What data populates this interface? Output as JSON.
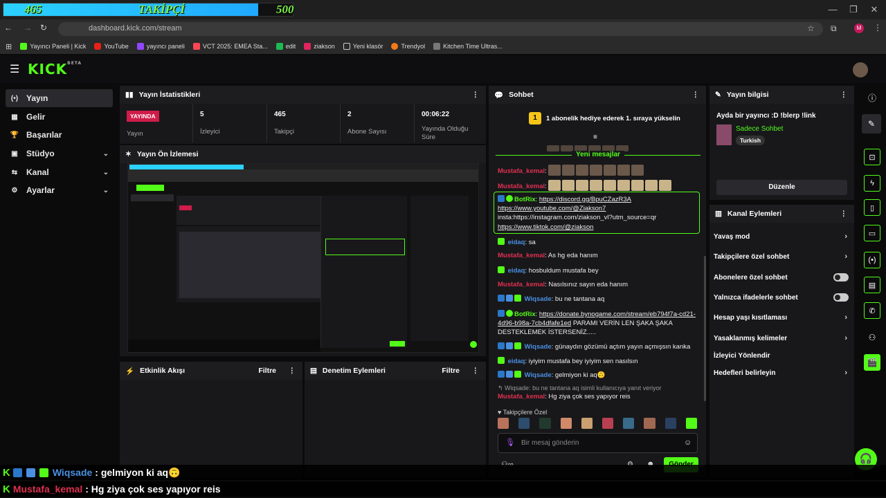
{
  "goal_bar": {
    "current": "465",
    "label": "TAKİPÇİ",
    "target": "500"
  },
  "browser": {
    "url": "dashboard.kick.com/stream",
    "bookmarks": [
      "Yayıncı Paneli | Kick",
      "YouTube",
      "yayıncı paneli",
      "VCT 2025: EMEA Sta...",
      "edit",
      "ziakson",
      "Yeni klasör",
      "Trendyol",
      "Kitchen Time Ultras..."
    ],
    "profile_initial": "M"
  },
  "header": {
    "logo": "KICK",
    "logo_sup": "BETA"
  },
  "sidebar": {
    "items": [
      {
        "label": "Yayın",
        "icon": "(•)"
      },
      {
        "label": "Gelir",
        "icon": "▦"
      },
      {
        "label": "Başarılar",
        "icon": "🏆"
      },
      {
        "label": "Stüdyo",
        "icon": "▣"
      },
      {
        "label": "Kanal",
        "icon": "⇆"
      },
      {
        "label": "Ayarlar",
        "icon": "⚙"
      }
    ]
  },
  "stats": {
    "title": "Yayın İstatistikleri",
    "live_badge": "YAYINDA",
    "status_label": "Yayın",
    "viewers": {
      "value": "5",
      "label": "İzleyici"
    },
    "followers": {
      "value": "465",
      "label": "Takipçi"
    },
    "subs": {
      "value": "2",
      "label": "Abone Sayısı"
    },
    "uptime": {
      "value": "00:06:22",
      "label": "Yayında Olduğu Süre"
    }
  },
  "preview": {
    "title": "Yayın Ön İzlemesi"
  },
  "activity": {
    "title": "Etkinlik Akışı",
    "filter": "Filtre"
  },
  "moderation": {
    "title": "Denetim Eylemleri",
    "filter": "Filtre"
  },
  "chat": {
    "title": "Sohbet",
    "pinned": "1 abonelik hediye ederek 1. sıraya yükselin",
    "pinned_rank": "1",
    "new_messages": "Yeni mesajlar",
    "botrix_name": "BotRix",
    "botrix_lines": [
      "https://discord.gg/BpuCZazR3A",
      "https://www.youtube.com/@Ziakson7",
      "insta:https://instagram.com/ziakson_vl?utm_source=qr",
      "https://www.tiktok.com/@ziakson"
    ],
    "messages": [
      {
        "user": "Mustafa_kemal",
        "text": ""
      },
      {
        "user": "Mustafa_kemal",
        "text": ""
      },
      {
        "user": "eidaq",
        "text": "sa"
      },
      {
        "user": "Mustafa_kemal",
        "text": "As hg eda hanım"
      },
      {
        "user": "eidaq",
        "text": "hosbuldum mustafa bey"
      },
      {
        "user": "Mustafa_kemal",
        "text": "Nasılsınız sayın eda hanım"
      },
      {
        "user": "Wiqsade",
        "text": "bu ne tantana aq"
      },
      {
        "user": "BotRix",
        "link": "https://donate.bynogame.com/stream/eb794f7a-cd21-",
        "link2": "4d96-b98a-7cb4dfafe1ed",
        "text": " PARAMI VERİN LEN ŞAKA ŞAKA",
        "text2": "DESTEKLEMEK İSTERSENİZ....."
      },
      {
        "user": "Wiqsade",
        "text": "günaydın gözümü açtım yayın açmışsın kanka"
      },
      {
        "user": "eidaq",
        "text": "iyiyim mustafa bey iyiyim sen nasılsın"
      },
      {
        "user": "Wiqsade",
        "text": "gelmiyon ki aq🙃"
      }
    ],
    "reply_note": "Wiqsade: bu ne tantana aq isimli kullanıcıya yanıt veriyor",
    "last_message": {
      "user": "Mustafa_kemal",
      "text": "Hg ziya çok ses yapıyor reis"
    },
    "followers_only_label": "Takipçilere Özel",
    "input_placeholder": "Bir mesaj gönderin",
    "send_button": "Gönder"
  },
  "stream_info": {
    "title": "Yayın bilgisi",
    "stream_title": "Ayda bir yayıncı :D !blerp !link",
    "category": "Sadece Sohbet",
    "tag": "Turkish",
    "edit_button": "Düzenle"
  },
  "channel_actions": {
    "title": "Kanal Eylemleri",
    "items": [
      {
        "label": "Yavaş mod",
        "type": "chevron"
      },
      {
        "label": "Takipçilere özel sohbet",
        "type": "chevron"
      },
      {
        "label": "Abonelere özel sohbet",
        "type": "toggle"
      },
      {
        "label": "Yalnızca ifadelerle sohbet",
        "type": "toggle"
      },
      {
        "label": "Hesap yaşı kısıtlaması",
        "type": "chevron"
      },
      {
        "label": "Yasaklanmış kelimeler",
        "type": "chevron"
      },
      {
        "label": "İzleyici Yönlendir",
        "type": "none"
      },
      {
        "label": "Hedefleri belirleyin",
        "type": "chevron"
      }
    ]
  },
  "overlay": {
    "line1": {
      "user": "Wiqsade",
      "text": ": gelmiyon ki aq🙃"
    },
    "line2": {
      "user": "Mustafa_kemal",
      "text": ": Hg ziya çok ses yapıyor reis"
    }
  },
  "colors": {
    "accent": "#53fc18",
    "live": "#d01c4a",
    "panel": "#18181b"
  }
}
